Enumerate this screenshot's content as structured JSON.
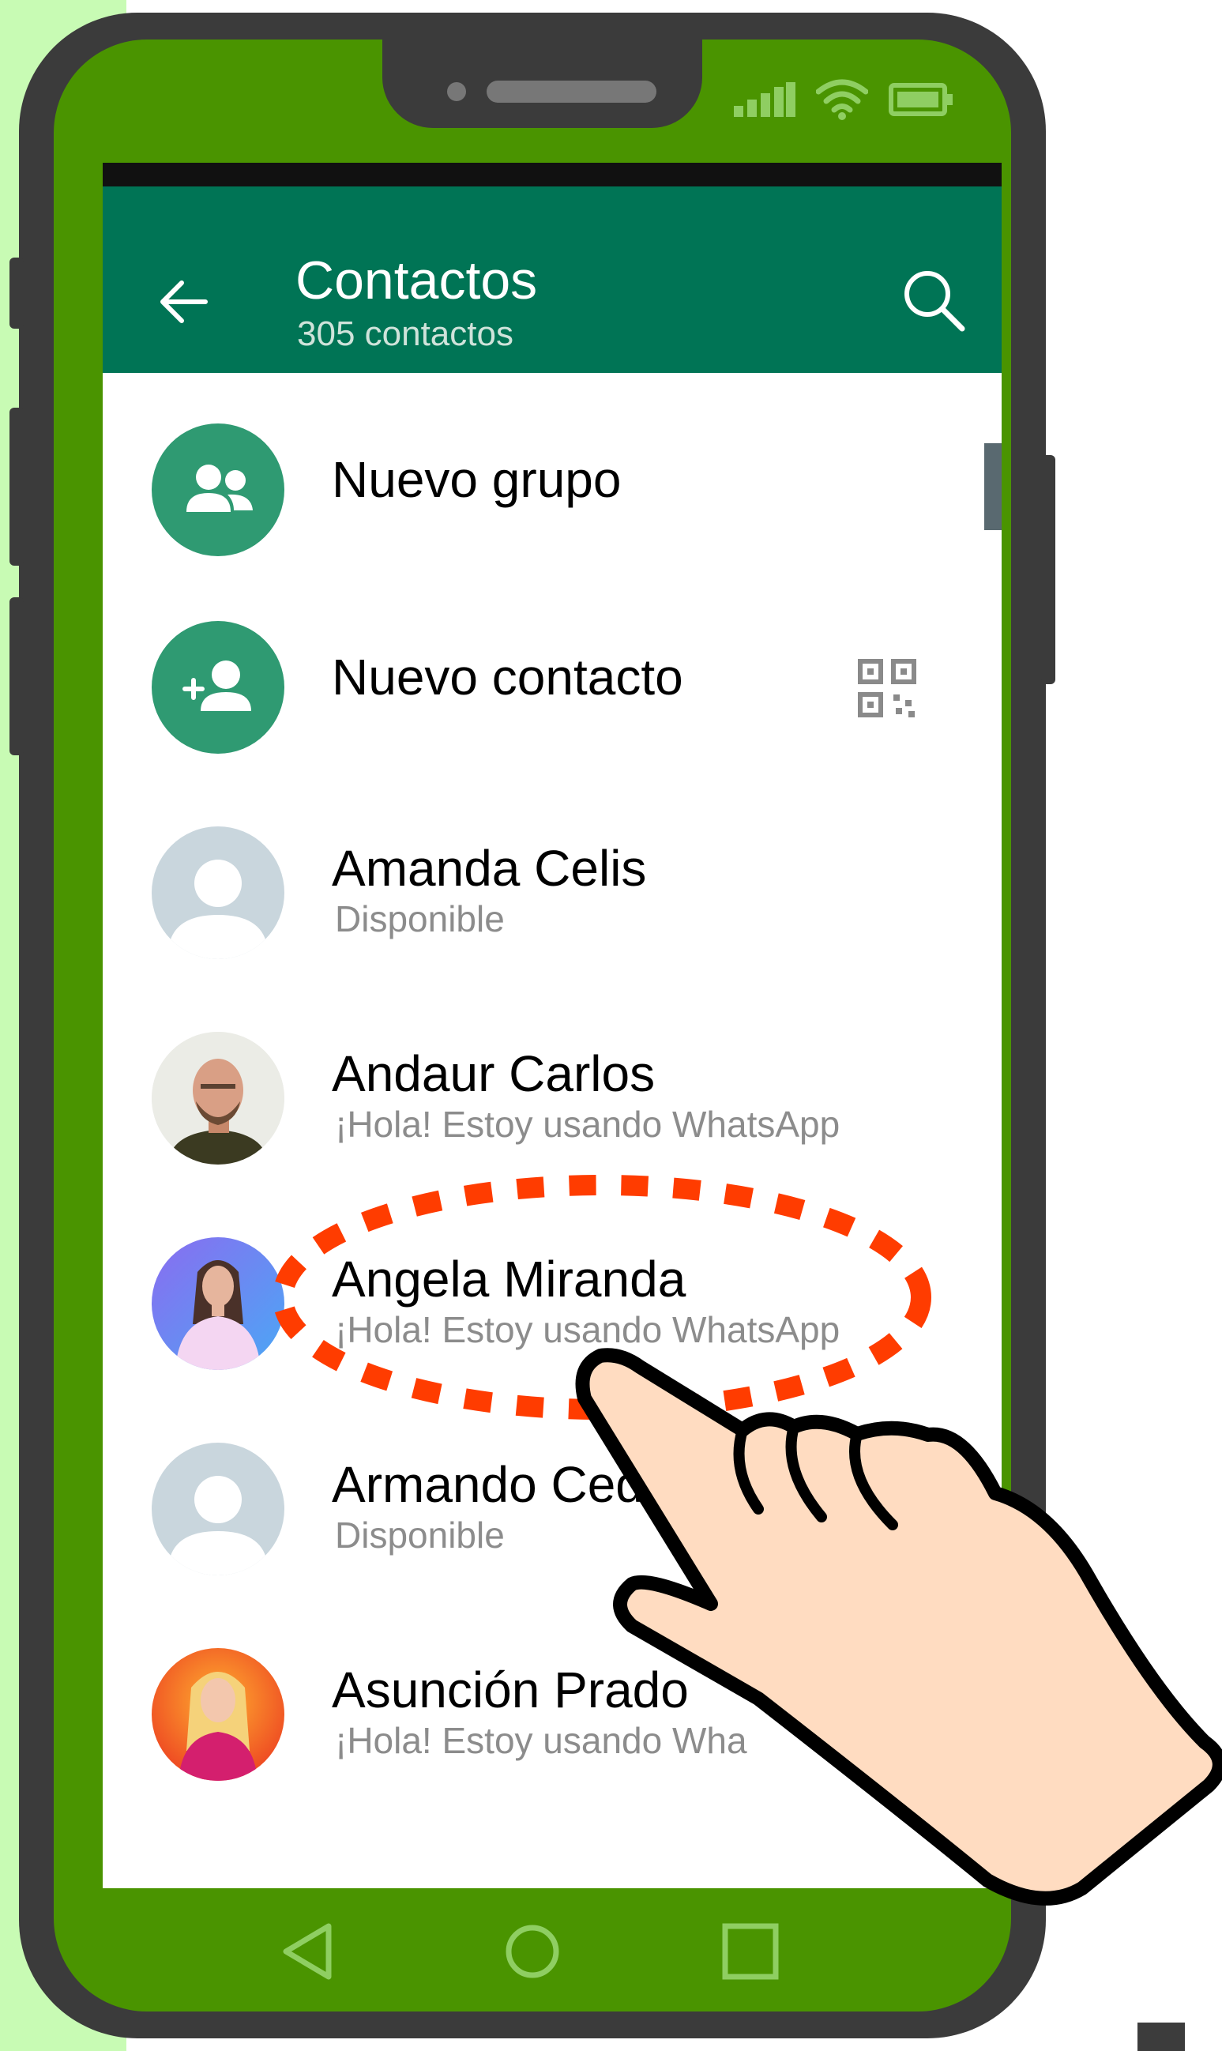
{
  "colors": {
    "appbar": "#007455",
    "phone_frame": "#3b3b3b",
    "phone_bezel": "#4a9400",
    "accent_avatar": "#2f9a72",
    "highlight": "#ff3c00",
    "hand_skin": "#ffdcc1"
  },
  "appbar": {
    "title": "Contactos",
    "subtitle": "305 contactos",
    "back_icon": "arrow-left-icon",
    "search_icon": "search-icon"
  },
  "actions": [
    {
      "label": "Nuevo grupo",
      "icon": "group-icon"
    },
    {
      "label": "Nuevo contacto",
      "icon": "add-person-icon",
      "trailing_icon": "qr-code-icon"
    }
  ],
  "contacts": [
    {
      "name": "Amanda Celis",
      "status": "Disponible",
      "avatar": "default-avatar-icon"
    },
    {
      "name": "Andaur Carlos",
      "status": "¡Hola! Estoy usando WhatsApp",
      "avatar": "bald-man-photo"
    },
    {
      "name": "Angela Miranda",
      "status": "¡Hola! Estoy usando WhatsApp",
      "avatar": "woman-photo",
      "highlighted": true
    },
    {
      "name": "Armando Ced",
      "status": "Disponible",
      "avatar": "default-avatar-icon"
    },
    {
      "name": "Asunción Prado",
      "status": "¡Hola! Estoy usando Wha",
      "avatar": "blonde-woman-photo"
    }
  ],
  "navigation": {
    "back_icon": "triangle-back-icon",
    "home_icon": "circle-home-icon",
    "recents_icon": "square-recents-icon"
  }
}
